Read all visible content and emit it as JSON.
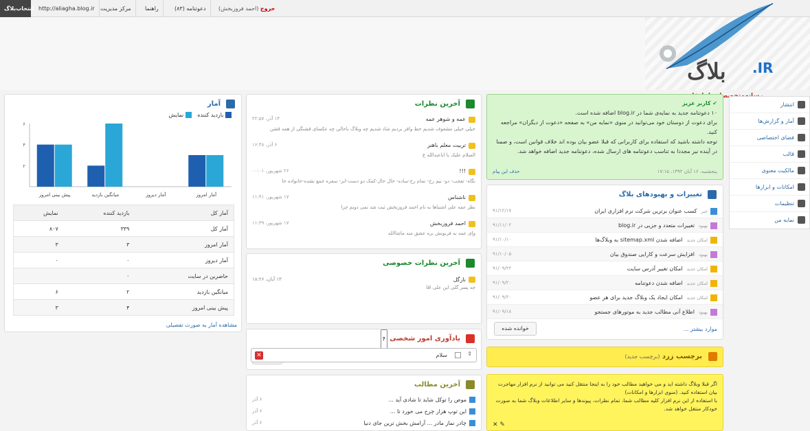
{
  "topbar": {
    "select_btn": "انتخاب‌بلاگ",
    "blog_url": "http://aliagha.blog.ir",
    "admin_center": "مرکز مدیریت",
    "help": "راهنما",
    "invitations": "دعوتنامه (۸۳)",
    "exit_label": "خروج",
    "exit_user": "(احمد فروزبخش)"
  },
  "logo": {
    "text": "بلاگ",
    "ir": ".IR",
    "tagline": "رسانه‌متخصصان‌واهل‌قلم"
  },
  "sidebar": {
    "items": [
      {
        "label": "انتشار",
        "icon": "publish-icon"
      },
      {
        "label": "آمار و گزارش‌ها",
        "icon": "stats-icon"
      },
      {
        "label": "فضای اختصاصی",
        "icon": "space-icon"
      },
      {
        "label": "قالب",
        "icon": "template-icon"
      },
      {
        "label": "مالکیت معنوی",
        "icon": "copyright-icon"
      },
      {
        "label": "امکانات و ابزارها",
        "icon": "tools-icon"
      },
      {
        "label": "تنظیمات",
        "icon": "settings-icon"
      },
      {
        "label": "نمایه من",
        "icon": "profile-icon"
      }
    ]
  },
  "notice": {
    "title": "کاربر عزیز",
    "line1": "۱۰ دعوتنامه جدید به نمایه‌ی شما در blog.ir اضافه شده است.",
    "line2": "برای دعوت از دوستان خود می‌توانید در منوی «نمایه من» به صفحه «دعوت از دیگران» مراجعه کنید.",
    "line3": "توجه داشته باشید که استفاده برای کاربرانی که قبلا عضو بیان بوده اند خلاف قوانین است، و ضمنا در آینده نیز مجددا به تناسب دعوتنامه های ارسال شده، دعوتنامه جدید اضافه خواهد شد.",
    "date": "پنجشنبه، ۱۶ آبان ۱۳۹۲، ۱۷:۱۵",
    "delete": "حذف این پیام"
  },
  "changes": {
    "title": "تغییرات و بهبودهای بلاگ",
    "rows": [
      {
        "tag": "خبر",
        "text": "کسب عنوان برترین شرکت نرم افزاری ایران",
        "date": "۹۱/۱۲/۱۷"
      },
      {
        "tag": "بهبود",
        "text": "تغییرات متعدد و جزیی در blog.ir",
        "date": "۹۱/۱۱/۰۲"
      },
      {
        "tag": "امکان جدید",
        "text": "اضافه شدن sitemap.xml به وبلاگ‌ها",
        "date": "۹۱/۱۰/۱۰"
      },
      {
        "tag": "بهبود",
        "text": "افزایش سرعت و کارایی صندوق بیان",
        "date": "۹۱/۱۰/۰۵"
      },
      {
        "tag": "امکان جدید",
        "text": "امکان تغییر آدرس سایت",
        "date": "۹۱/۰۹/۲۲"
      },
      {
        "tag": "امکان جدید",
        "text": "اضافه شدن دعوتنامه",
        "date": "۹۱/۰۹/۲۰"
      },
      {
        "tag": "امکان جدید",
        "text": "امکان ایجاد یک وبلاگ جدید برای هر عضو",
        "date": "۹۱/۰۹/۲۰"
      },
      {
        "tag": "بهبود",
        "text": "اطلاع آنی مطالب جدید به موتورهای جستجو",
        "date": "۹۱/۰۹/۱۸"
      }
    ],
    "more": "موارد بیشتر ...",
    "read_btn": "خوانده شده"
  },
  "yellow_label": {
    "title": "برچسب زرد",
    "sub": "(برچسب جدید)",
    "body1": "اگر قبلا وبلاگ داشته اید و می خواهید مطالب خود را به اینجا منتقل کنید می توانید از نرم افزار مهاجرت بیان استفاده کنید. (منوی ابزارها و امکانات)",
    "body2": "با استفاده از این نرم افزار کلیه مطالب شما، تمام نظرات، پیوندها و سایر اطلاعات وبلاگ شما به صورت خودکار منتقل خواهد شد."
  },
  "comments": {
    "title": "آخرین نظرات",
    "rows": [
      {
        "name": "عمه و شوهر عمه",
        "date": "۱۴ آذر، ۲۲:۵۷",
        "text": "خیلی خیلی مشعوف شدیم حظ وافر بردیم شاد شدیم چه وبلاگ باحالی چه عکسای قشنگی از همه قشن"
      },
      {
        "name": "تربیت معلم باهنر",
        "date": "۶ آذر، ۱۶:۴۸",
        "text": "السلام علیک یا اباعبدالله ع"
      },
      {
        "name": "!!!",
        "date": "۲۶ شهریور، ۰۰:۰۱",
        "text": "نگاه- تعجب- دو- نیم رخ- تمام رخ-ساده- خال خال-کمک دو دست-ابر- سفره جمع نشده-خانواده حا"
      },
      {
        "name": "ناشناس",
        "date": "۱۷ شهریور، ۱۱:۴۱",
        "text": "نظر عمه علی اشتباها به نام احمد فروزبخش ثبت شد نمی دونم چرا"
      },
      {
        "name": "احمد فروزبخش",
        "date": "۱۷ شهریور، ۱۱:۳۹",
        "text": "واِی عمه به فربونش بره عشق منه ماشاالله"
      }
    ]
  },
  "private_comments": {
    "title": "آخرین نظرات خصوصی",
    "name": "نازگل",
    "date": "۱۳ آبان، ۱۸:۲۶",
    "text": "چه پسر گلی این علی اقا"
  },
  "todo": {
    "title": "یادآوری امور شخصی",
    "new_btn": "کار جدید",
    "item": "سلام"
  },
  "posts": {
    "title": "آخرین مطالب",
    "rows": [
      {
        "text": "موص را توکل شاید تا شادی آید ...",
        "date": "۶ آذر"
      },
      {
        "text": "این توپ هزار چرخ می خورد تا ...",
        "date": "۶ آذر"
      },
      {
        "text": "چادر نماز مادر ... آرامش بخش ترین جای دنیا",
        "date": "۶ آذر"
      }
    ]
  },
  "stats": {
    "title": "آمار",
    "legend_visitors": "بازدید کننده",
    "legend_views": "نمایش",
    "table_headers": [
      "آمار کل",
      "بازدید کننده",
      "نمایش"
    ],
    "rows": [
      [
        "آمار کل",
        "۳۳۹",
        "۸۰۷"
      ],
      [
        "آمار امروز",
        "۳",
        "۳"
      ],
      [
        "آمار دیروز",
        "۰",
        "۰"
      ],
      [
        "حاضرین در سایت",
        "۰",
        ""
      ],
      [
        "میانگین بازدید",
        "۲",
        "۶"
      ],
      [
        "پیش بینی امروز",
        "۴",
        "۳"
      ]
    ],
    "detail_link": "مشاهده آمار به صورت تفصیلی"
  },
  "chart_data": {
    "type": "bar",
    "categories": [
      "پیش بینی امروز",
      "میانگین بازدید",
      "آمار دیروز",
      "آمار امروز"
    ],
    "series": [
      {
        "name": "بازدید کننده",
        "values": [
          4,
          2,
          0,
          3
        ]
      },
      {
        "name": "نمایش",
        "values": [
          4,
          6,
          0,
          3
        ]
      }
    ],
    "ylim": [
      0,
      6
    ],
    "yticks": [
      "۶",
      "۴",
      "۲"
    ],
    "colors": {
      "visitors": "#1f5fb0",
      "views": "#2aa7d6"
    },
    "legend": "top-right"
  }
}
